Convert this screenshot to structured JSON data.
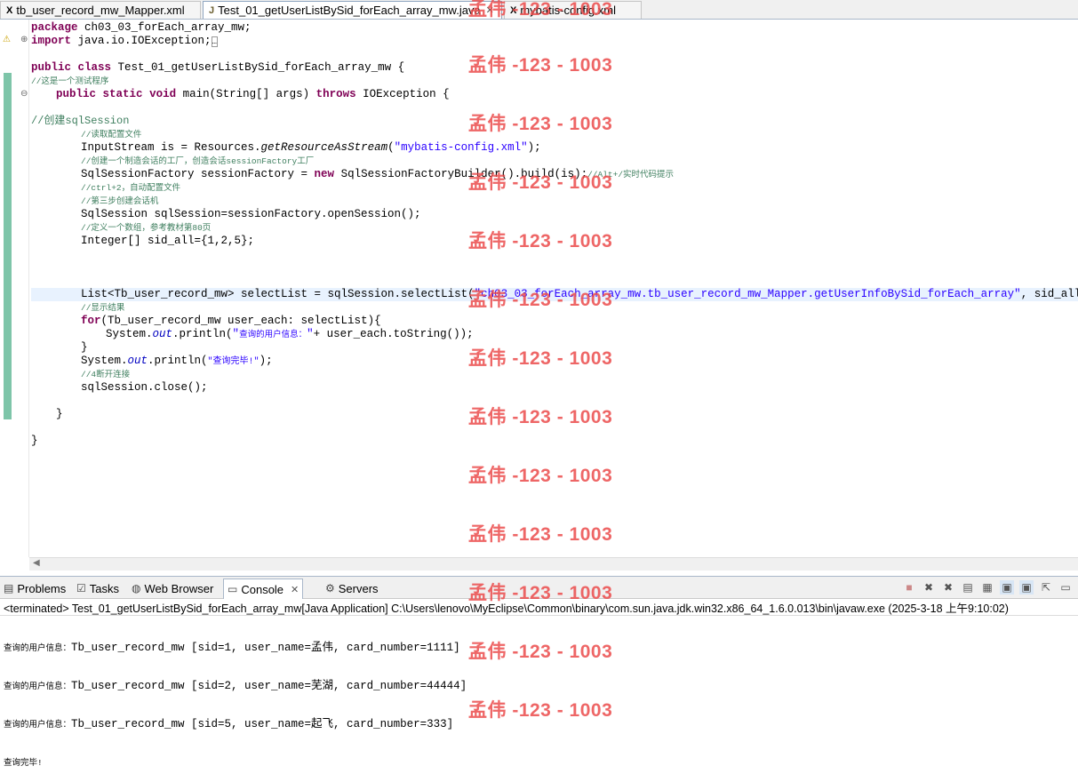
{
  "editor_tabs": [
    {
      "label": "tb_user_record_mw_Mapper.xml",
      "icon": "xml-file-icon"
    },
    {
      "label": "Test_01_getUserListBySid_forEach_array_mw.java",
      "icon": "java-file-icon"
    },
    {
      "label": "mybatis-config.xml",
      "icon": "xml-file-icon"
    }
  ],
  "code": {
    "l1_kw": "package",
    "l1": " ch03_03_forEach_array_mw;",
    "l2_kw": "import",
    "l2": " java.io.IOException;",
    "l3_kw1": "public",
    "l3_kw2": "class",
    "l3": " Test_01_getUserListBySid_forEach_array_mw {",
    "l4": "//这是一个测试程序",
    "l5_kw1": "public",
    "l5_kw2": "static",
    "l5_kw3": "void",
    "l5a": " main(String[] args) ",
    "l5_kw4": "throws",
    "l5b": " IOException {",
    "l6": "//创建sqlSession",
    "l7": "//读取配置文件",
    "l8a": "InputStream is = Resources.",
    "l8_it": "getResourceAsStream",
    "l8b": "(",
    "l8_str": "\"mybatis-config.xml\"",
    "l8c": ");",
    "l9": "//创建一个制造会话的工厂，创造会话sessionFactory工厂",
    "l10a": "SqlSessionFactory sessionFactory = ",
    "l10_kw": "new",
    "l10b": " SqlSessionFactoryBuilder().build(is);",
    "l10_cm": "//Alt+/实时代码提示",
    "l11": "//ctrl+2，自动配置文件",
    "l12": "//第三步创建会话机",
    "l13": "SqlSession sqlSession=sessionFactory.openSession();",
    "l14": "//定义一个数组，参考教材第80页",
    "l15": "Integer[] sid_all={1,2,5};",
    "l16a": "List<Tb_user_record_mw> selectList = sqlSession.selectList(",
    "l16_str": "\"ch03_03_forEach_array_mw.tb_user_record_mw_Mapper.getUserInfoBySid_forEach_array\"",
    "l16b": ", sid_all);",
    "l16_cm": "//",
    "l17": "//显示结果",
    "l18_kw": "for",
    "l18": "(Tb_user_record_mw user_each: selectList){",
    "l19a": "System.",
    "l19_fld": "out",
    "l19b": ".println(",
    "l19_str1": "\"",
    "l19_str_zh": "查询的用户信息：",
    "l19_str2": "\"",
    "l19c": "+ user_each.toString());",
    "l20": "}",
    "l21a": "System.",
    "l21_fld": "out",
    "l21b": ".println(",
    "l21_str": "\"查询完毕!\"",
    "l21c": ");",
    "l22": "//4断开连接",
    "l23": "sqlSession.close();",
    "l24": "}",
    "l25": "}"
  },
  "watermark": "孟伟 -123 - 1003",
  "panel_tabs": [
    {
      "label": "Problems",
      "icon": "problems-icon"
    },
    {
      "label": "Tasks",
      "icon": "tasks-icon"
    },
    {
      "label": "Web Browser",
      "icon": "globe-icon"
    },
    {
      "label": "Console",
      "icon": "console-icon"
    },
    {
      "label": "Servers",
      "icon": "servers-icon"
    }
  ],
  "console": {
    "header": "<terminated> Test_01_getUserListBySid_forEach_array_mw[Java Application] C:\\Users\\lenovo\\MyEclipse\\Common\\binary\\com.sun.java.jdk.win32.x86_64_1.6.0.013\\bin\\javaw.exe (2025-3-18 上午9:10:02)",
    "zh_prefix": "查询的用户信息：",
    "rows": [
      "Tb_user_record_mw [sid=1, user_name=孟伟, card_number=1111]",
      "Tb_user_record_mw [sid=2, user_name=芜湖, card_number=44444]",
      "Tb_user_record_mw [sid=5, user_name=起飞, card_number=333]"
    ],
    "done": "查询完毕!"
  },
  "colors": {
    "keyword": "#7f0055",
    "comment": "#3f7f5f",
    "string": "#2a00ff",
    "field": "#0000c0",
    "watermark": "#eb4b4b"
  }
}
